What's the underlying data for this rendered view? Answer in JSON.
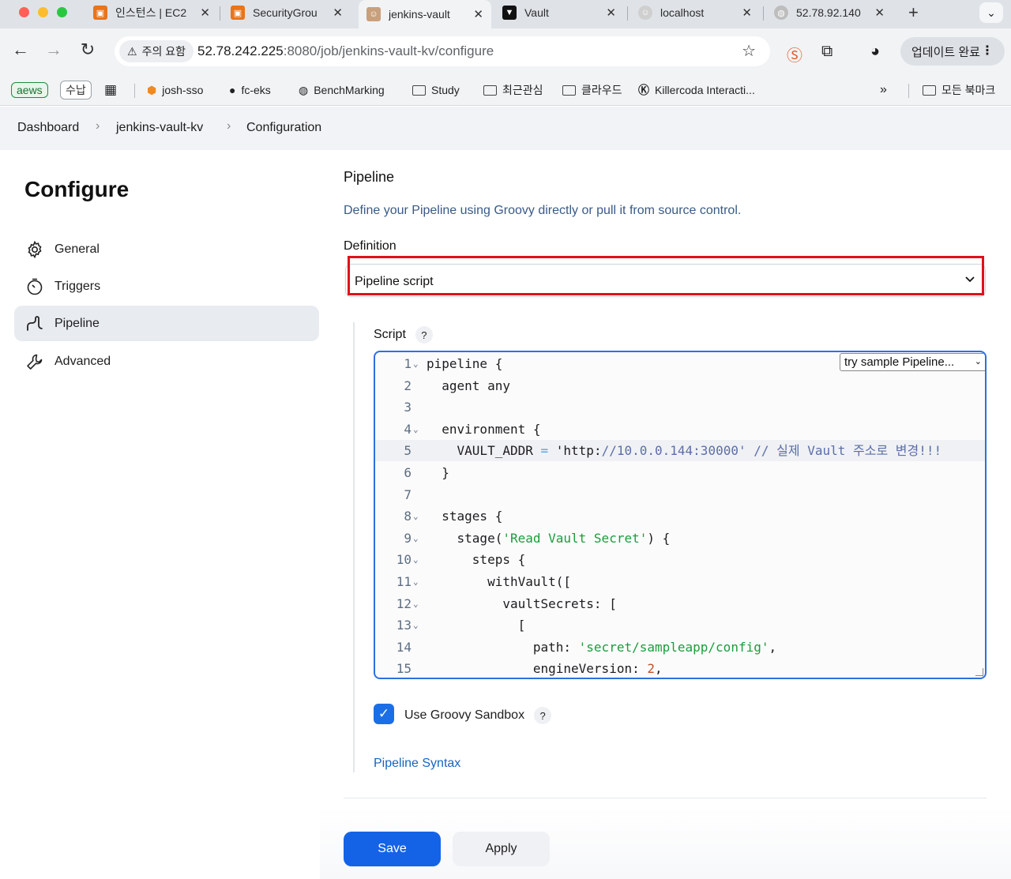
{
  "browser": {
    "tabs": [
      {
        "title": "인스턴스 | EC2",
        "favicon": "aws-ec2-icon",
        "color": "#e8741b"
      },
      {
        "title": "SecurityGrou",
        "favicon": "aws-ec2-icon",
        "color": "#e8741b"
      },
      {
        "title": "jenkins-vault",
        "favicon": "jenkins-icon",
        "color": "#c9a07b"
      },
      {
        "title": "Vault",
        "favicon": "vault-icon",
        "color": "#111111"
      },
      {
        "title": "localhost",
        "favicon": "jenkins-icon",
        "color": "#cccccc"
      },
      {
        "title": "52.78.92.140",
        "favicon": "globe-icon",
        "color": "#bdbdbd"
      }
    ],
    "security_chip": "주의 요함",
    "url_host": "52.78.242.225",
    "url_path": ":8080/job/jenkins-vault-kv/configure",
    "update_button": "업데이트 완료",
    "bookmarks": {
      "chip1": "aews",
      "chip2": "수납",
      "items": [
        "josh-sso",
        "fc-eks",
        "BenchMarking",
        "Study",
        "최근관심",
        "클라우드",
        "Killercoda Interacti..."
      ],
      "overflow": "»",
      "all_bookmarks": "모든 북마크"
    }
  },
  "breadcrumb": {
    "items": [
      "Dashboard",
      "jenkins-vault-kv",
      "Configuration"
    ]
  },
  "sidebar": {
    "title": "Configure",
    "items": [
      {
        "label": "General",
        "icon": "gear-icon"
      },
      {
        "label": "Triggers",
        "icon": "clock-icon"
      },
      {
        "label": "Pipeline",
        "icon": "pipeline-icon"
      },
      {
        "label": "Advanced",
        "icon": "wrench-icon"
      }
    ],
    "active_index": 2
  },
  "pipeline": {
    "title": "Pipeline",
    "description": "Define your Pipeline using Groovy directly or pull it from source control.",
    "definition_label": "Definition",
    "definition_value": "Pipeline script",
    "script_label": "Script",
    "help_glyph": "?",
    "sample_select": "try sample Pipeline...",
    "code_lines": [
      {
        "n": "1",
        "fold": true,
        "text": "pipeline {"
      },
      {
        "n": "2",
        "fold": false,
        "text": "  agent any"
      },
      {
        "n": "3",
        "fold": false,
        "text": ""
      },
      {
        "n": "4",
        "fold": true,
        "text": "  environment {"
      },
      {
        "n": "5",
        "fold": false,
        "text": "    VAULT_ADDR = 'http://10.0.0.144:30000' // 실제 Vault 주소로 변경!!!"
      },
      {
        "n": "6",
        "fold": false,
        "text": "  }"
      },
      {
        "n": "7",
        "fold": false,
        "text": ""
      },
      {
        "n": "8",
        "fold": true,
        "text": "  stages {"
      },
      {
        "n": "9",
        "fold": true,
        "text": "    stage('Read Vault Secret') {"
      },
      {
        "n": "10",
        "fold": true,
        "text": "      steps {"
      },
      {
        "n": "11",
        "fold": true,
        "text": "        withVault(["
      },
      {
        "n": "12",
        "fold": true,
        "text": "          vaultSecrets: ["
      },
      {
        "n": "13",
        "fold": true,
        "text": "            ["
      },
      {
        "n": "14",
        "fold": false,
        "text": "              path: 'secret/sampleapp/config',"
      },
      {
        "n": "15",
        "fold": false,
        "text": "              engineVersion: 2,"
      }
    ],
    "current_line": 5,
    "sandbox_label": "Use Groovy Sandbox",
    "sandbox_checked": true,
    "syntax_link": "Pipeline Syntax"
  },
  "actions": {
    "save": "Save",
    "apply": "Apply"
  },
  "colors": {
    "primary": "#1463e6",
    "highlight": "#e0101a",
    "string": "#1a9e3a",
    "comment": "#5b6ea8",
    "number": "#c0522a"
  }
}
